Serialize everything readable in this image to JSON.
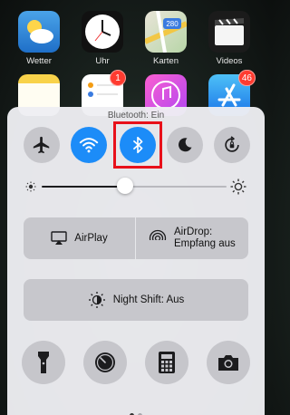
{
  "home_apps": [
    {
      "label": "Wetter",
      "icon": "weather-icon"
    },
    {
      "label": "Uhr",
      "icon": "clock-icon"
    },
    {
      "label": "Karten",
      "icon": "maps-icon",
      "sign": "280"
    },
    {
      "label": "Videos",
      "icon": "videos-icon"
    },
    {
      "label": "",
      "icon": "notes-icon"
    },
    {
      "label": "",
      "icon": "reminders-icon",
      "badge": "1"
    },
    {
      "label": "",
      "icon": "itunes-icon"
    },
    {
      "label": "",
      "icon": "appstore-icon",
      "badge": "46"
    }
  ],
  "control_center": {
    "status": "Bluetooth: Ein",
    "toggles": [
      {
        "name": "airplane-mode",
        "icon": "airplane-icon",
        "state": "off"
      },
      {
        "name": "wifi",
        "icon": "wifi-icon",
        "state": "on"
      },
      {
        "name": "bluetooth",
        "icon": "bluetooth-icon",
        "state": "on",
        "highlighted": true
      },
      {
        "name": "do-not-disturb",
        "icon": "moon-icon",
        "state": "off"
      },
      {
        "name": "rotation-lock",
        "icon": "rotation-lock-icon",
        "state": "off"
      }
    ],
    "brightness": 0.45,
    "airplay_label": "AirPlay",
    "airdrop_label_line1": "AirDrop:",
    "airdrop_label_line2": "Empfang aus",
    "nightshift_label": "Night Shift: Aus",
    "tools": [
      {
        "name": "flashlight",
        "icon": "flashlight-icon"
      },
      {
        "name": "timer",
        "icon": "timer-icon"
      },
      {
        "name": "calculator",
        "icon": "calculator-icon"
      },
      {
        "name": "camera",
        "icon": "camera-icon"
      }
    ],
    "page_count": 2,
    "current_page": 0
  },
  "colors": {
    "accent": "#1c8cf8",
    "highlight_box": "#e8101a",
    "toggle_off": "#c6c6cb"
  }
}
